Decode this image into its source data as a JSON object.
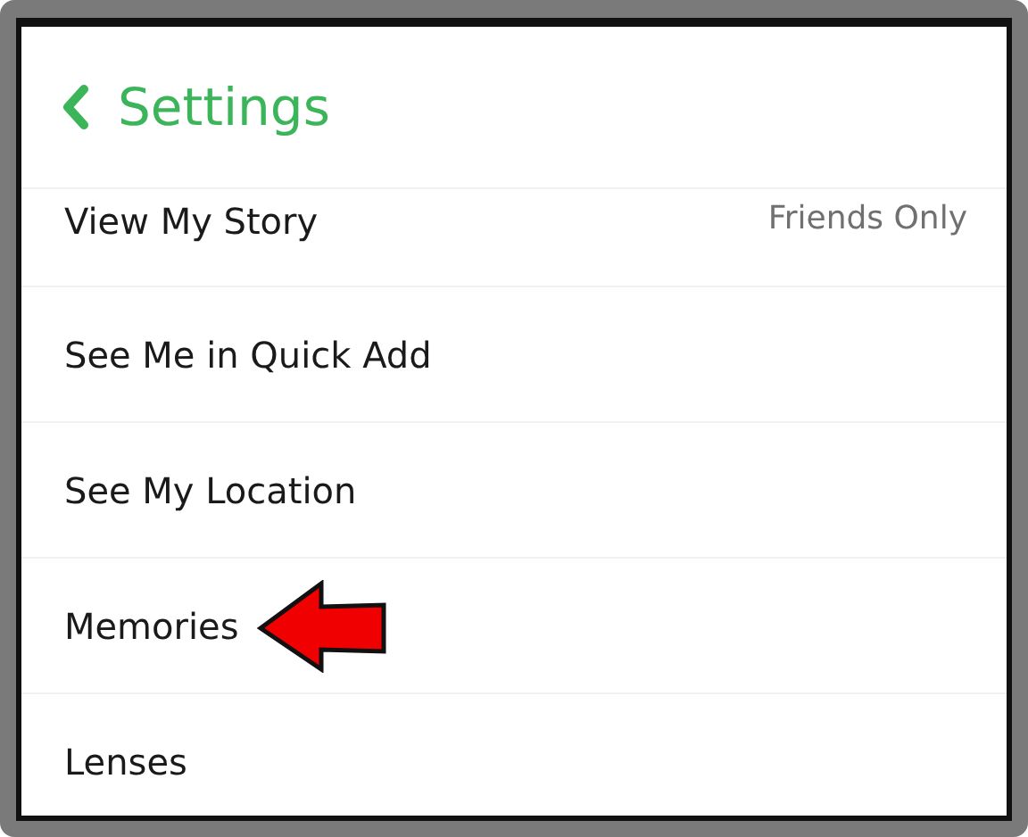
{
  "header": {
    "title": "Settings"
  },
  "items": [
    {
      "label": "View My Story",
      "value": "Friends Only",
      "pointed_at": false
    },
    {
      "label": "See Me in Quick Add",
      "pointed_at": false
    },
    {
      "label": "See My Location",
      "pointed_at": false
    },
    {
      "label": "Memories",
      "pointed_at": true
    },
    {
      "label": "Lenses",
      "pointed_at": false
    }
  ]
}
